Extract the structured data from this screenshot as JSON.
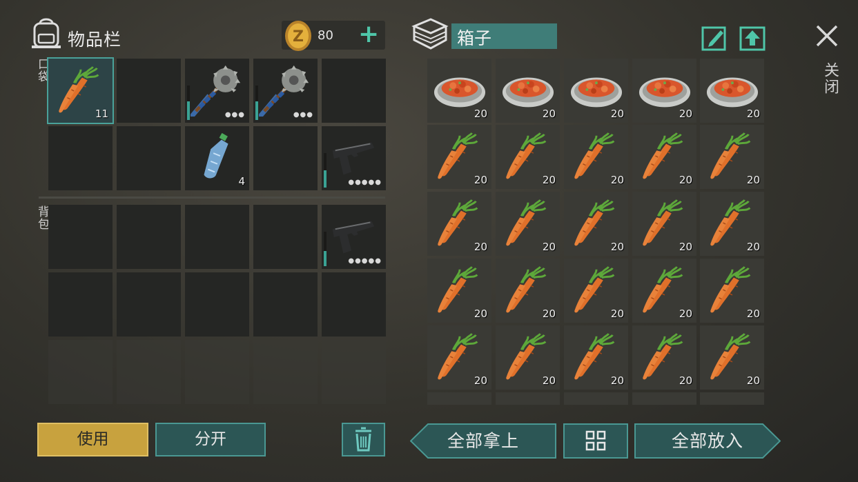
{
  "inventory": {
    "title": "物品栏",
    "coins": "80",
    "coin_plus": "+",
    "pocket_label": "口袋",
    "backpack_label": "背包",
    "pocket_slots": [
      {
        "item": "carrot",
        "qty": "11",
        "selected": true
      },
      {
        "item": "",
        "qty": ""
      },
      {
        "item": "saw-club",
        "qty": "",
        "durability": 0.55
      },
      {
        "item": "saw-club",
        "qty": "",
        "durability": 0.55
      },
      {
        "item": "",
        "qty": ""
      },
      {
        "item": "",
        "qty": ""
      },
      {
        "item": "",
        "qty": ""
      },
      {
        "item": "water-bottle",
        "qty": "4"
      },
      {
        "item": "",
        "qty": ""
      },
      {
        "item": "pistol",
        "qty": "",
        "durability": 0.5
      }
    ],
    "backpack_slots": [
      {
        "item": "",
        "qty": ""
      },
      {
        "item": "",
        "qty": ""
      },
      {
        "item": "",
        "qty": ""
      },
      {
        "item": "",
        "qty": ""
      },
      {
        "item": "pistol",
        "qty": "",
        "durability": 0.45
      }
    ]
  },
  "container": {
    "name": "箱子",
    "rows": [
      [
        "20",
        "20",
        "20",
        "20",
        "20"
      ],
      [
        "20",
        "20",
        "20",
        "20",
        "20"
      ],
      [
        "20",
        "20",
        "20",
        "20",
        "20"
      ],
      [
        "20",
        "20",
        "20",
        "20",
        "20"
      ],
      [
        "20",
        "20",
        "20",
        "20",
        "20"
      ]
    ],
    "row_items": [
      "food-plate",
      "carrot",
      "carrot",
      "carrot",
      "carrot"
    ]
  },
  "buttons": {
    "use": "使用",
    "split": "分开",
    "take_all": "全部拿上",
    "put_all": "全部放入",
    "close": "关闭"
  },
  "colors": {
    "accent": "#3aa394",
    "use_button": "#c8a23e",
    "name_field": "#3f7d78"
  },
  "icons": {
    "bag": "backpack-icon",
    "coin": "coin-icon",
    "box": "box-icon",
    "edit": "edit-icon",
    "upload": "upload-icon",
    "close": "close-icon",
    "trash": "trash-icon",
    "sort": "grid-icon"
  }
}
